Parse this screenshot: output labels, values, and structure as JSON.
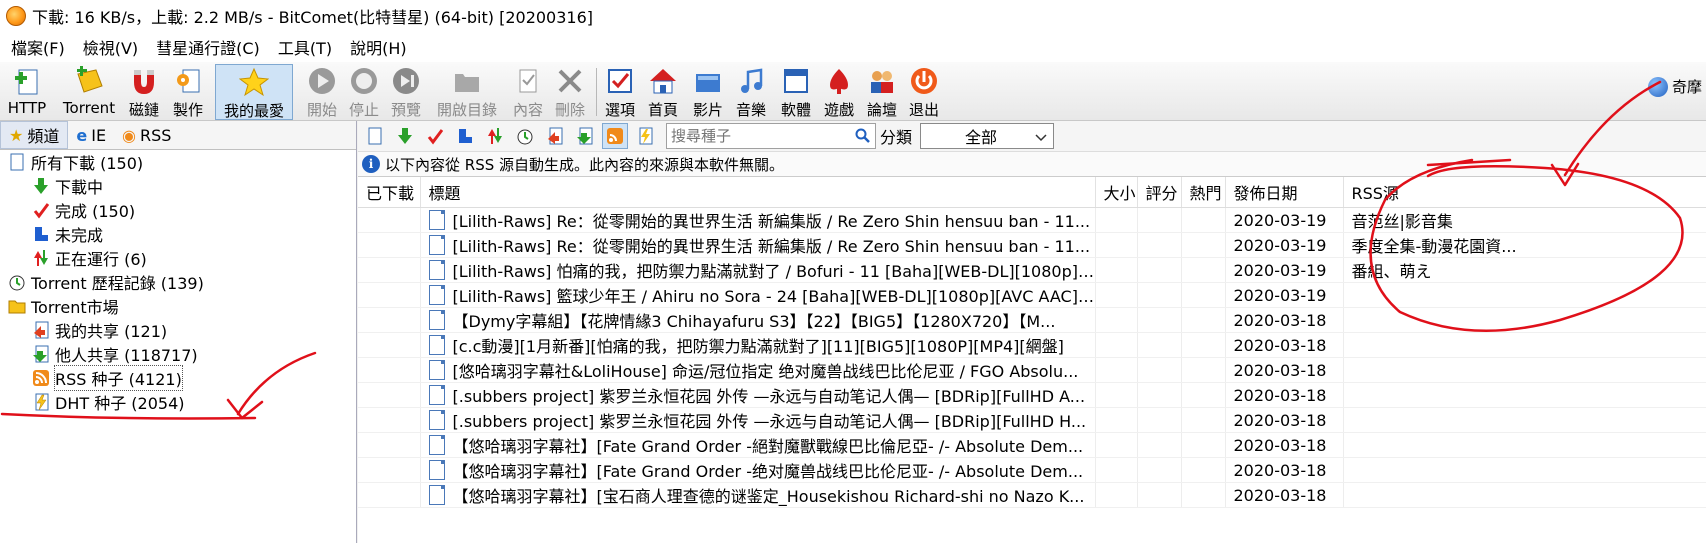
{
  "window": {
    "title": "下載: 16 KB/s，上載: 2.2 MB/s - BitComet(比特彗星) (64-bit) [20200316]"
  },
  "menu": [
    "檔案(F)",
    "檢視(V)",
    "彗星通行證(C)",
    "工具(T)",
    "說明(H)"
  ],
  "toolbar": {
    "buttons": [
      {
        "label": "HTTP",
        "icon": "http-add-icon",
        "enabled": true
      },
      {
        "label": "Torrent",
        "icon": "torrent-add-icon",
        "enabled": true
      },
      {
        "label": "磁鏈",
        "icon": "magnet-icon",
        "enabled": true
      },
      {
        "label": "製作",
        "icon": "make-torrent-icon",
        "enabled": true
      },
      {
        "label": "我的最愛",
        "icon": "star-icon",
        "enabled": true,
        "active": true
      },
      {
        "label": "開始",
        "icon": "play-icon",
        "enabled": false
      },
      {
        "label": "停止",
        "icon": "stop-icon",
        "enabled": false
      },
      {
        "label": "預覽",
        "icon": "preview-icon",
        "enabled": false
      },
      {
        "label": "開啟目錄",
        "icon": "folder-open-icon",
        "enabled": false
      },
      {
        "label": "內容",
        "icon": "properties-icon",
        "enabled": false
      },
      {
        "label": "刪除",
        "icon": "delete-icon",
        "enabled": false
      },
      {
        "label": "選項",
        "icon": "options-icon",
        "enabled": true
      },
      {
        "label": "首頁",
        "icon": "home-icon",
        "enabled": true
      },
      {
        "label": "影片",
        "icon": "video-icon",
        "enabled": true
      },
      {
        "label": "音樂",
        "icon": "music-icon",
        "enabled": true
      },
      {
        "label": "軟體",
        "icon": "software-icon",
        "enabled": true
      },
      {
        "label": "遊戲",
        "icon": "game-icon",
        "enabled": true
      },
      {
        "label": "論壇",
        "icon": "forum-icon",
        "enabled": true
      },
      {
        "label": "退出",
        "icon": "power-icon",
        "enabled": true
      }
    ],
    "corner_label": "奇摩"
  },
  "sidebar": {
    "tabs": [
      {
        "label": "頻道",
        "icon": "star-icon",
        "active": true
      },
      {
        "label": "IE",
        "icon": "ie-icon",
        "active": false
      },
      {
        "label": "RSS",
        "icon": "rss-icon",
        "active": false
      }
    ],
    "tree": [
      {
        "label": "所有下載 (150)",
        "level": 0,
        "icon": "all-downloads-icon"
      },
      {
        "label": "下載中",
        "level": 1,
        "icon": "arrow-down-icon"
      },
      {
        "label": "完成 (150)",
        "level": 1,
        "icon": "checkmark-icon"
      },
      {
        "label": "未完成",
        "level": 1,
        "icon": "incomplete-icon"
      },
      {
        "label": "正在運行 (6)",
        "level": 1,
        "icon": "running-icon"
      },
      {
        "label": "Torrent 歷程記錄 (139)",
        "level": 0,
        "icon": "history-icon"
      },
      {
        "label": "Torrent市場",
        "level": 0,
        "icon": "market-folder-icon"
      },
      {
        "label": "我的共享 (121)",
        "level": 1,
        "icon": "my-share-icon"
      },
      {
        "label": "他人共享 (118717)",
        "level": 1,
        "icon": "others-share-icon"
      },
      {
        "label": "RSS 种子 (4121)",
        "level": 1,
        "icon": "rss-icon",
        "selected": true
      },
      {
        "label": "DHT 种子 (2054)",
        "level": 1,
        "icon": "dht-icon"
      }
    ]
  },
  "main": {
    "search": {
      "placeholder": "搜尋種子"
    },
    "category_label": "分類",
    "category_value": "全部",
    "info_text": "以下內容從 RSS 源自動生成。此內容的來源與本軟件無關。",
    "columns": [
      "已下載",
      "標題",
      "大小",
      "評分",
      "熱門",
      "發佈日期",
      "RSS源"
    ],
    "rows": [
      {
        "title": "[Lilith-Raws] Re：從零開始的異世界生活 新編集版 / Re Zero Shin hensuu ban - 11...",
        "date": "2020-03-19",
        "rss": "音范丝|影音集"
      },
      {
        "title": "[Lilith-Raws] Re：從零開始的異世界生活 新編集版 / Re Zero Shin hensuu ban - 11...",
        "date": "2020-03-19",
        "rss": "季度全集-動漫花園資..."
      },
      {
        "title": "[Lilith-Raws] 怕痛的我，把防禦力點滿就對了 / Bofuri - 11 [Baha][WEB-DL][1080p][...",
        "date": "2020-03-19",
        "rss": "番組、萌え"
      },
      {
        "title": "[Lilith-Raws] 籃球少年王 / Ahiru no Sora - 24 [Baha][WEB-DL][1080p][AVC AAC][C...",
        "date": "2020-03-19",
        "rss": ""
      },
      {
        "title": "【Dymy字幕組】【花牌情緣3 Chihayafuru S3】【22】【BIG5】【1280X720】【M...",
        "date": "2020-03-18",
        "rss": ""
      },
      {
        "title": "[c.c動漫][1月新番][怕痛的我，把防禦力點滿就對了][11][BIG5][1080P][MP4][網盤]",
        "date": "2020-03-18",
        "rss": ""
      },
      {
        "title": "[悠哈璃羽字幕社&LoliHouse] 命运/冠位指定 绝对魔兽战线巴比伦尼亚 / FGO Absolu...",
        "date": "2020-03-18",
        "rss": ""
      },
      {
        "title": "[.subbers project] 紫罗兰永恒花园 外传 —永远与自动笔记人偶— [BDRip][FullHD A...",
        "date": "2020-03-18",
        "rss": ""
      },
      {
        "title": "[.subbers project] 紫罗兰永恒花园 外传 —永远与自动笔记人偶— [BDRip][FullHD H...",
        "date": "2020-03-18",
        "rss": ""
      },
      {
        "title": "【悠哈璃羽字幕社】[Fate Grand Order -絕對魔獸戰線巴比倫尼亞- /- Absolute Dem...",
        "date": "2020-03-18",
        "rss": ""
      },
      {
        "title": "【悠哈璃羽字幕社】[Fate Grand Order -绝对魔兽战线巴比伦尼亚- /- Absolute Dem...",
        "date": "2020-03-18",
        "rss": ""
      },
      {
        "title": "【悠哈璃羽字幕社】[宝石商人理查德的谜鉴定_Housekishou Richard-shi no Nazo K...",
        "date": "2020-03-18",
        "rss": ""
      }
    ]
  },
  "colors": {
    "annotation": "#e0101a",
    "selection": "#cfe3f6",
    "accent": "#1f5fbf"
  }
}
